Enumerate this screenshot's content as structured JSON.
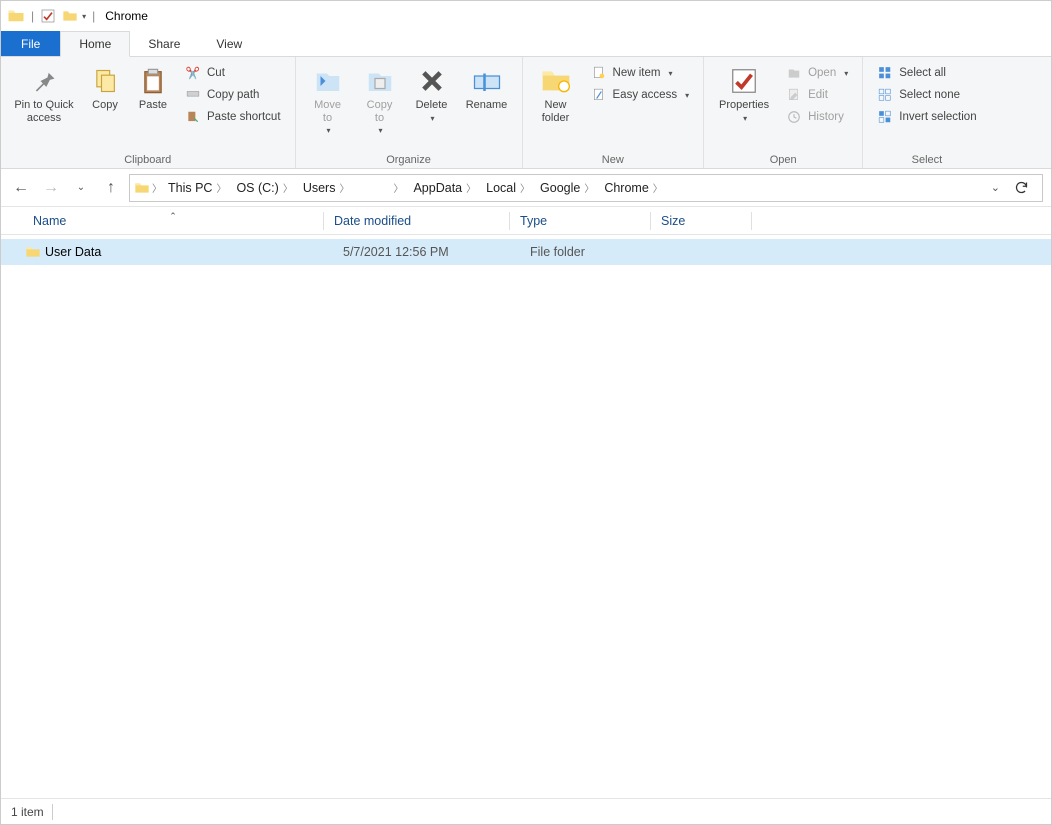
{
  "title": "Chrome",
  "tabs": {
    "file": "File",
    "home": "Home",
    "share": "Share",
    "view": "View"
  },
  "ribbon": {
    "clipboard": {
      "label": "Clipboard",
      "pin": "Pin to Quick\naccess",
      "copy": "Copy",
      "paste": "Paste",
      "cut": "Cut",
      "copy_path": "Copy path",
      "paste_shortcut": "Paste shortcut"
    },
    "organize": {
      "label": "Organize",
      "move_to": "Move\nto",
      "copy_to": "Copy\nto",
      "delete": "Delete",
      "rename": "Rename"
    },
    "new": {
      "label": "New",
      "new_folder": "New\nfolder",
      "new_item": "New item",
      "easy_access": "Easy access"
    },
    "open": {
      "label": "Open",
      "properties": "Properties",
      "open": "Open",
      "edit": "Edit",
      "history": "History"
    },
    "select": {
      "label": "Select",
      "select_all": "Select all",
      "select_none": "Select none",
      "invert": "Invert selection"
    }
  },
  "breadcrumbs": [
    "This PC",
    "OS (C:)",
    "Users",
    "",
    "AppData",
    "Local",
    "Google",
    "Chrome"
  ],
  "columns": {
    "name": "Name",
    "date": "Date modified",
    "type": "Type",
    "size": "Size"
  },
  "rows": [
    {
      "name": "User Data",
      "date": "5/7/2021 12:56 PM",
      "type": "File folder",
      "size": ""
    }
  ],
  "status": {
    "count": "1 item"
  }
}
